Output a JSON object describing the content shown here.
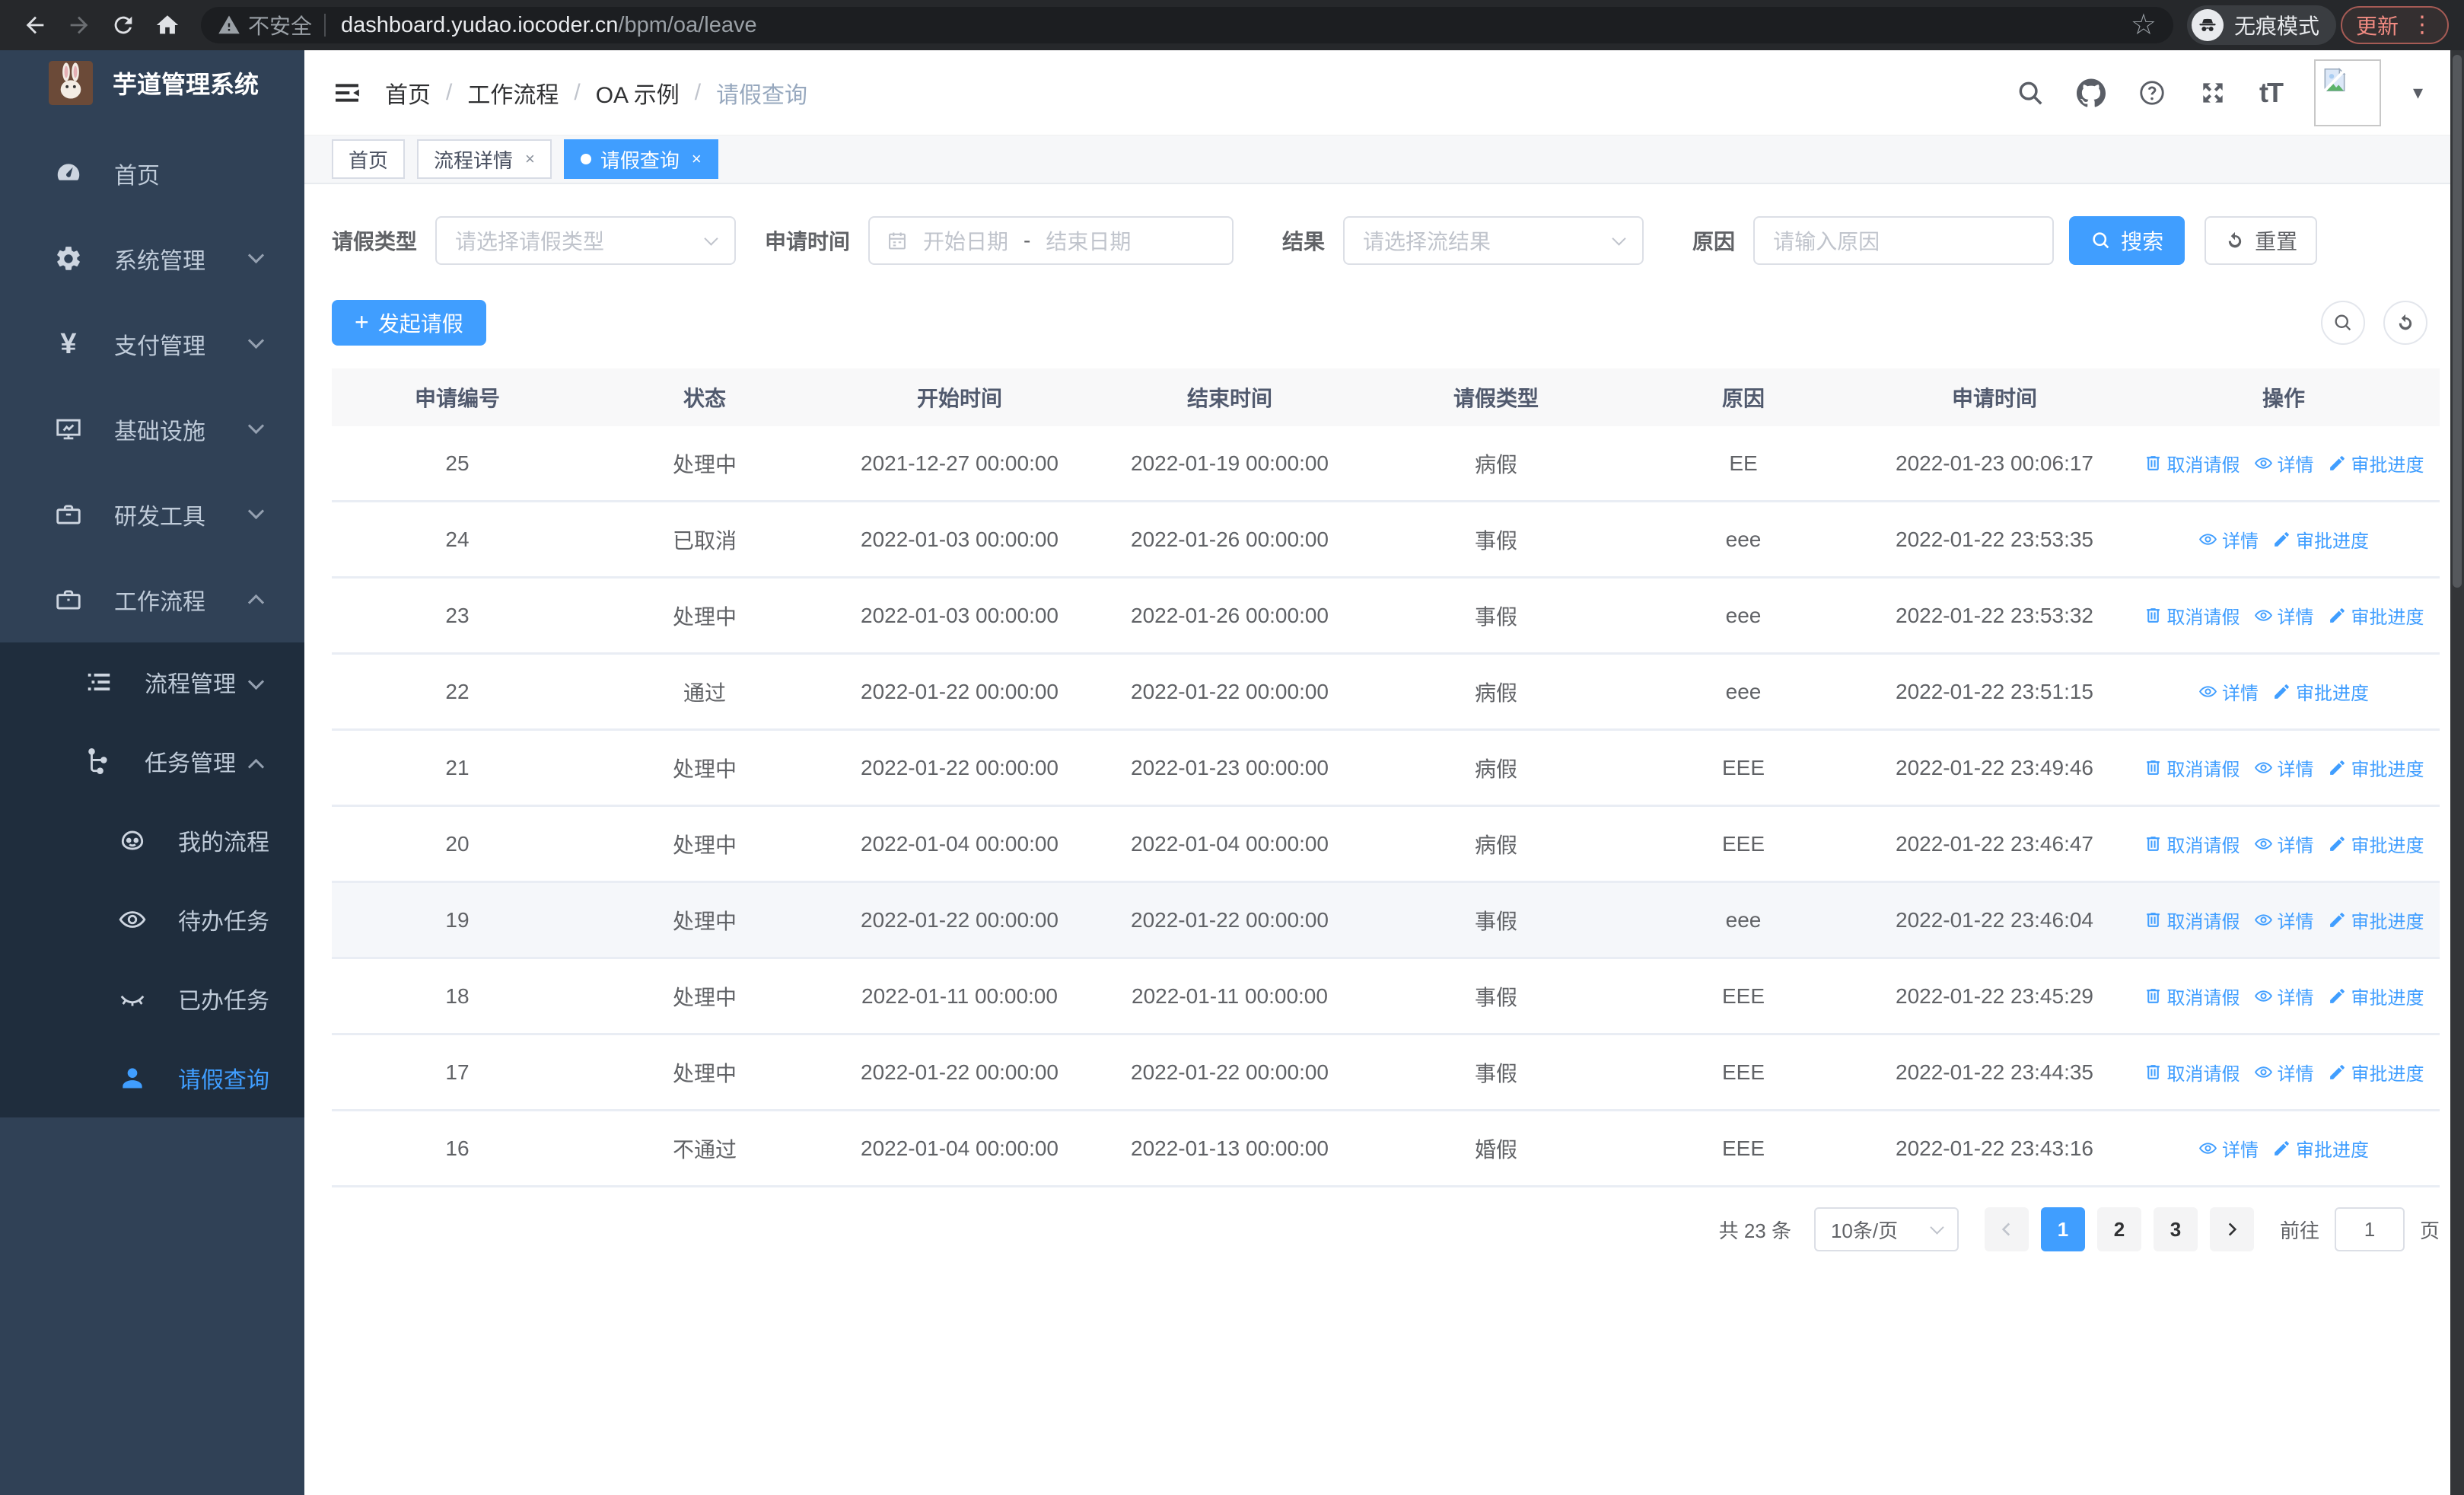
{
  "colors": {
    "accent": "#409eff",
    "sidebar_bg": "#304156",
    "submenu_bg": "#1f2d3d",
    "update_chip": "#f28b82"
  },
  "browser": {
    "security_label": "不安全",
    "url_host": "dashboard.yudao.iocoder.cn",
    "url_path": "/bpm/oa/leave",
    "incognito_label": "无痕模式",
    "update_label": "更新"
  },
  "sidebar": {
    "title": "芋道管理系统",
    "items": [
      {
        "label": "首页"
      },
      {
        "label": "系统管理"
      },
      {
        "label": "支付管理"
      },
      {
        "label": "基础设施"
      },
      {
        "label": "研发工具"
      },
      {
        "label": "工作流程"
      },
      {
        "label": "流程管理"
      },
      {
        "label": "任务管理"
      },
      {
        "label": "我的流程"
      },
      {
        "label": "待办任务"
      },
      {
        "label": "已办任务"
      },
      {
        "label": "请假查询"
      }
    ]
  },
  "breadcrumb": {
    "separator": "/",
    "items": [
      "首页",
      "工作流程",
      "OA 示例",
      "请假查询"
    ]
  },
  "tabs": [
    {
      "label": "首页"
    },
    {
      "label": "流程详情",
      "close": "×"
    },
    {
      "label": "请假查询",
      "close": "×"
    }
  ],
  "filters": {
    "leave_type_label": "请假类型",
    "leave_type_placeholder": "请选择请假类型",
    "apply_time_label": "申请时间",
    "start_date_placeholder": "开始日期",
    "range_separator": "-",
    "end_date_placeholder": "结束日期",
    "result_label": "结果",
    "result_placeholder": "请选择流结果",
    "reason_label": "原因",
    "reason_placeholder": "请输入原因",
    "search_button": "搜索",
    "reset_button": "重置"
  },
  "toolbar": {
    "create_button": "发起请假"
  },
  "table": {
    "columns": [
      "申请编号",
      "状态",
      "开始时间",
      "结束时间",
      "请假类型",
      "原因",
      "申请时间",
      "操作"
    ],
    "action_labels": {
      "cancel": "取消请假",
      "detail": "详情",
      "progress": "审批进度"
    },
    "rows": [
      {
        "id": "25",
        "status": "处理中",
        "start": "2021-12-27 00:00:00",
        "end": "2022-01-19 00:00:00",
        "type": "病假",
        "reason": "EE",
        "apply": "2022-01-23 00:06:17"
      },
      {
        "id": "24",
        "status": "已取消",
        "start": "2022-01-03 00:00:00",
        "end": "2022-01-26 00:00:00",
        "type": "事假",
        "reason": "eee",
        "apply": "2022-01-22 23:53:35"
      },
      {
        "id": "23",
        "status": "处理中",
        "start": "2022-01-03 00:00:00",
        "end": "2022-01-26 00:00:00",
        "type": "事假",
        "reason": "eee",
        "apply": "2022-01-22 23:53:32"
      },
      {
        "id": "22",
        "status": "通过",
        "start": "2022-01-22 00:00:00",
        "end": "2022-01-22 00:00:00",
        "type": "病假",
        "reason": "eee",
        "apply": "2022-01-22 23:51:15"
      },
      {
        "id": "21",
        "status": "处理中",
        "start": "2022-01-22 00:00:00",
        "end": "2022-01-23 00:00:00",
        "type": "病假",
        "reason": "EEE",
        "apply": "2022-01-22 23:49:46"
      },
      {
        "id": "20",
        "status": "处理中",
        "start": "2022-01-04 00:00:00",
        "end": "2022-01-04 00:00:00",
        "type": "病假",
        "reason": "EEE",
        "apply": "2022-01-22 23:46:47"
      },
      {
        "id": "19",
        "status": "处理中",
        "start": "2022-01-22 00:00:00",
        "end": "2022-01-22 00:00:00",
        "type": "事假",
        "reason": "eee",
        "apply": "2022-01-22 23:46:04"
      },
      {
        "id": "18",
        "status": "处理中",
        "start": "2022-01-11 00:00:00",
        "end": "2022-01-11 00:00:00",
        "type": "事假",
        "reason": "EEE",
        "apply": "2022-01-22 23:45:29"
      },
      {
        "id": "17",
        "status": "处理中",
        "start": "2022-01-22 00:00:00",
        "end": "2022-01-22 00:00:00",
        "type": "事假",
        "reason": "EEE",
        "apply": "2022-01-22 23:44:35"
      },
      {
        "id": "16",
        "status": "不通过",
        "start": "2022-01-04 00:00:00",
        "end": "2022-01-13 00:00:00",
        "type": "婚假",
        "reason": "EEE",
        "apply": "2022-01-22 23:43:16"
      }
    ]
  },
  "pagination": {
    "total_label": "共 23 条",
    "page_size": "10条/页",
    "pages": [
      "1",
      "2",
      "3"
    ],
    "goto_label": "前往",
    "goto_value": "1",
    "page_unit": "页"
  }
}
